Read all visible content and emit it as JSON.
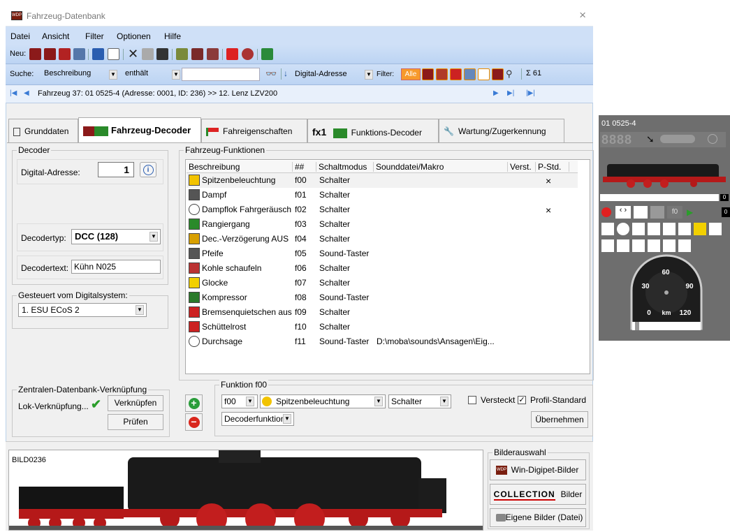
{
  "window": {
    "title": "Fahrzeug-Datenbank",
    "close": "×"
  },
  "menu": [
    "Datei",
    "Ansicht",
    "Filter",
    "Optionen",
    "Hilfe"
  ],
  "toolbar": {
    "new_label": "Neu:"
  },
  "search": {
    "label": "Suche:",
    "field": "Beschreibung",
    "operator": "enthält",
    "value": "",
    "sort_field": "Digital-Adresse",
    "filter_label": "Filter:",
    "filter_all": "Alle",
    "count": "Σ 61"
  },
  "nav": {
    "record": "Fahrzeug 37: 01 0525-4 (Adresse: 0001, ID: 236) >> 12. Lenz LZV200"
  },
  "tabs": [
    "Grunddaten",
    "Fahrzeug-Decoder",
    "Fahreigenschaften",
    "Funktions-Decoder",
    "Wartung/Zugerkennung"
  ],
  "tab_fx": "fx1",
  "decoder": {
    "group": "Decoder",
    "address_label": "Digital-Adresse:",
    "address": "1",
    "type_label": "Decodertyp:",
    "type": "DCC (128)",
    "text_label": "Decodertext:",
    "text": "Kühn N025"
  },
  "controlled": {
    "group": "Gesteuert vom Digitalsystem:",
    "system": "1. ESU ECoS 2"
  },
  "functions": {
    "group": "Fahrzeug-Funktionen",
    "columns": [
      "Beschreibung",
      "##",
      "Schaltmodus",
      "Sounddatei/Makro",
      "Verst.",
      "P-Std."
    ],
    "rows": [
      {
        "desc": "Spitzenbeleuchtung",
        "num": "f00",
        "mode": "Schalter",
        "file": "",
        "hidden": "",
        "pstd": "×"
      },
      {
        "desc": "Dampf",
        "num": "f01",
        "mode": "Schalter",
        "file": "",
        "hidden": "",
        "pstd": ""
      },
      {
        "desc": "Dampflok Fahrgeräusch",
        "num": "f02",
        "mode": "Schalter",
        "file": "",
        "hidden": "",
        "pstd": "×"
      },
      {
        "desc": "Rangiergang",
        "num": "f03",
        "mode": "Schalter",
        "file": "",
        "hidden": "",
        "pstd": ""
      },
      {
        "desc": "Dec.-Verzögerung AUS",
        "num": "f04",
        "mode": "Schalter",
        "file": "",
        "hidden": "",
        "pstd": ""
      },
      {
        "desc": "Pfeife",
        "num": "f05",
        "mode": "Sound-Taster",
        "file": "",
        "hidden": "",
        "pstd": ""
      },
      {
        "desc": "Kohle schaufeln",
        "num": "f06",
        "mode": "Schalter",
        "file": "",
        "hidden": "",
        "pstd": ""
      },
      {
        "desc": "Glocke",
        "num": "f07",
        "mode": "Schalter",
        "file": "",
        "hidden": "",
        "pstd": ""
      },
      {
        "desc": "Kompressor",
        "num": "f08",
        "mode": "Sound-Taster",
        "file": "",
        "hidden": "",
        "pstd": ""
      },
      {
        "desc": "Bremsenquietschen aus",
        "num": "f09",
        "mode": "Schalter",
        "file": "",
        "hidden": "",
        "pstd": ""
      },
      {
        "desc": "Schüttelrost",
        "num": "f10",
        "mode": "Schalter",
        "file": "",
        "hidden": "",
        "pstd": ""
      },
      {
        "desc": "Durchsage",
        "num": "f11",
        "mode": "Sound-Taster",
        "file": "D:\\moba\\sounds\\Ansagen\\Eig...",
        "hidden": "",
        "pstd": ""
      }
    ]
  },
  "central": {
    "group": "Zentralen-Datenbank-Verknüpfung",
    "label": "Lok-Verknüpfung...",
    "link_button": "Verknüpfen",
    "check_button": "Prüfen"
  },
  "function_edit": {
    "group": "Funktion f00",
    "num": "f00",
    "desc": "Spitzenbeleuchtung",
    "mode": "Schalter",
    "kind": "Decoderfunktion",
    "hidden_label": "Versteckt",
    "profile_label": "Profil-Standard",
    "apply_button": "Übernehmen"
  },
  "image": {
    "caption": "BILD0236",
    "group": "Bilderauswahl",
    "btn_wdp": "Win-Digipet-Bilder",
    "collection_word": "COLLECTION",
    "btn_collection": "Bilder",
    "btn_own": "Eigene Bilder (Datei)"
  },
  "side": {
    "name": "01 0525-4",
    "digits": "8888",
    "bar_value": "0",
    "f0": "f0",
    "speed_value": "0",
    "speed_unit": "km",
    "tacho": [
      "30",
      "60",
      "90",
      "0",
      "120"
    ]
  },
  "colors": {
    "accent": "#cfe0f7",
    "selected_row": "#f2f2f2",
    "panel": "#6e6e6e",
    "check": "#2a9d2a",
    "remove": "#d9261c"
  }
}
